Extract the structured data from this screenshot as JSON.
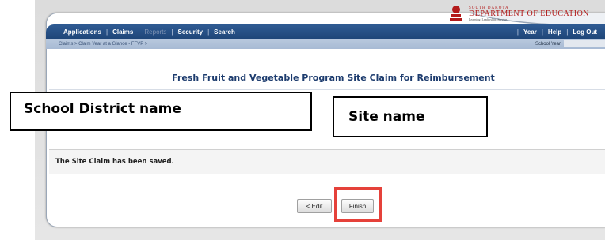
{
  "logo": {
    "line1": "SOUTH DAKOTA",
    "line2": "DEPARTMENT OF EDUCATION",
    "line3": "Learning. Leadership. Service."
  },
  "nav": {
    "left_items": [
      "Applications",
      "Claims",
      "Reports",
      "Security",
      "Search"
    ],
    "disabled_item": "Reports",
    "right_items": [
      "Year",
      "Help",
      "Log Out"
    ]
  },
  "breadcrumb": "Claims > Claim Year at a Glance - FFVP >",
  "school_year_label": "School Year",
  "page_title": "Fresh Fruit and Vegetable Program Site Claim for Reimbursement",
  "overlays": {
    "district": "School District name",
    "site": "Site name"
  },
  "message": "The Site Claim has been saved.",
  "buttons": {
    "edit": "< Edit",
    "finish": "Finish"
  },
  "colors": {
    "nav_bg": "#2f5b93",
    "crumb_bg": "#b9c9de",
    "title": "#1d3c6e",
    "highlight": "#e5413a"
  }
}
